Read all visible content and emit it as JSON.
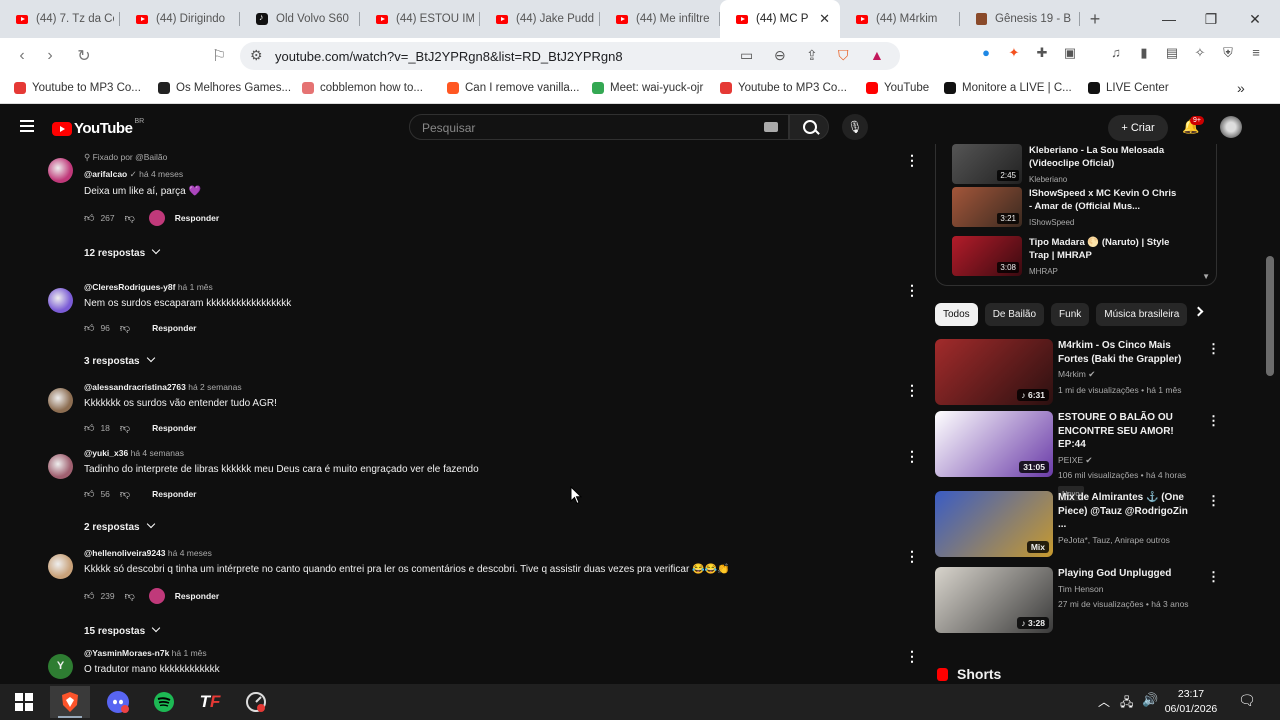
{
  "browser": {
    "tabs": [
      {
        "title": "(44) 7. Tz da Co",
        "icon": "youtube-icon"
      },
      {
        "title": "(44) Dirigindo",
        "icon": "youtube-icon"
      },
      {
        "title": "Old Volvo S60",
        "icon": "tiktok-icon"
      },
      {
        "title": "(44) ESTOU IM",
        "icon": "youtube-icon"
      },
      {
        "title": "(44) Jake Pudd",
        "icon": "youtube-icon"
      },
      {
        "title": "(44) Me infiltre",
        "icon": "youtube-icon"
      },
      {
        "title": "(44) MC P",
        "icon": "youtube-icon",
        "active": true
      },
      {
        "title": "(44) M4rkim",
        "icon": "youtube-icon"
      },
      {
        "title": "Gênesis 19 - B",
        "icon": "book-icon"
      }
    ],
    "new_tab": "+",
    "window_controls": {
      "minimize": "—",
      "maximize": "❐",
      "close": "✕"
    },
    "url": "youtube.com/watch?v=_BtJ2YPRgn8&list=RD_BtJ2YPRgn8",
    "brave_badge": "44",
    "bookmarks": [
      {
        "label": "Youtube to MP3 Co...",
        "color": "#e53935"
      },
      {
        "label": "Os Melhores Games...",
        "color": "#222"
      },
      {
        "label": "cobblemon how to...",
        "color": "#e57373"
      },
      {
        "label": "Can I remove vanilla...",
        "color": "#ff5722"
      },
      {
        "label": "Meet: wai-yuck-ojr",
        "color": "#34a853"
      },
      {
        "label": "Youtube to MP3 Co...",
        "color": "#e53935"
      },
      {
        "label": "YouTube",
        "color": "#ff0000"
      },
      {
        "label": "Monitore a LIVE | C...",
        "color": "#111"
      },
      {
        "label": "LIVE Center",
        "color": "#111"
      }
    ],
    "bookmarks_more": "»"
  },
  "youtube": {
    "logo_text": "YouTube",
    "logo_region": "BR",
    "search_placeholder": "Pesquisar",
    "create_label": "Criar",
    "notification_badge": "9+"
  },
  "comments": [
    {
      "pinned": "Fixado por @Bailão",
      "user": "@arifalcao",
      "verified": "✓",
      "time": "há 4 meses",
      "text": "Deixa um like aí, parça 💜",
      "likes": "267",
      "creator_heart": true,
      "reply_label": "Responder",
      "replies": "12 respostas",
      "avatar": "#c0397a"
    },
    {
      "user": "@CleresRodrigues-y8f",
      "time": "há 1 mês",
      "text": "Nem os surdos escaparam kkkkkkkkkkkkkkkkk",
      "likes": "96",
      "reply_label": "Responder",
      "replies": "3 respostas",
      "avatar": "#7b5cd6"
    },
    {
      "user": "@alessandracristina2763",
      "time": "há 2 semanas",
      "text": "Kkkkkkk os surdos vão entender tudo AGR!",
      "likes": "18",
      "reply_label": "Responder",
      "avatar": "#8d6e52"
    },
    {
      "user": "@yuki_x36",
      "time": "há 4 semanas",
      "text": "Tadinho do interprete de libras kkkkkk meu Deus cara é muito engraçado ver ele fazendo",
      "likes": "56",
      "reply_label": "Responder",
      "replies": "2 respostas",
      "avatar": "#a06070"
    },
    {
      "user": "@hellenoliveira9243",
      "time": "há 4 meses",
      "text": "Kkkkk só descobri q tinha um intérprete no canto quando entrei pra ler os comentários e descobri. Tive q assistir duas vezes pra verificar 😂😂👏",
      "likes": "239",
      "creator_heart": true,
      "reply_label": "Responder",
      "replies": "15 respostas",
      "avatar": "#c9a27a"
    },
    {
      "user": "@YasminMoraes-n7k",
      "time": "há 1 mês",
      "text": "O tradutor mano kkkkkkkkkkkk",
      "avatar": "#2e7d32",
      "avatar_letter": "Y"
    }
  ],
  "playlist": [
    {
      "title": "Kleberiano - La Sou Melosada (Videoclipe Oficial)",
      "channel": "Kleberiano",
      "duration": "2:45",
      "colors": [
        "#555",
        "#222"
      ]
    },
    {
      "title": "IShowSpeed x MC Kevin O Chris - Amar de (Official Mus...",
      "channel": "IShowSpeed",
      "duration": "3:21",
      "colors": [
        "#a3563a",
        "#3b2a20"
      ]
    },
    {
      "title": "Tipo Madara 🌕 (Naruto) | Style Trap | MHRAP",
      "channel": "MHRAP",
      "duration": "3:08",
      "colors": [
        "#b31c2a",
        "#3a0a10"
      ]
    }
  ],
  "chips": [
    {
      "label": "Todos",
      "active": true
    },
    {
      "label": "De Bailão"
    },
    {
      "label": "Funk"
    },
    {
      "label": "Música brasileira"
    }
  ],
  "videos": [
    {
      "title": "M4rkim - Os Cinco Mais Fortes (Baki the Grappler)",
      "channel": "M4rkim",
      "verified": true,
      "meta": "1 mi de visualizações • há 1 mês",
      "duration": "♪ 6:31",
      "colors": [
        "#a22b2b",
        "#2b1010"
      ]
    },
    {
      "title": "ESTOURE O BALÃO OU ENCONTRE SEU AMOR! EP:44",
      "channel": "PEIXE",
      "verified": true,
      "meta": "106 mil visualizações • há 4 horas",
      "new_badge": "Novo",
      "duration": "31:05",
      "colors": [
        "#ffffff",
        "#6a3ba8"
      ]
    },
    {
      "title": "Mix de Almirantes ⚓ (One Piece) @Tauz @RodrigoZin ...",
      "channel": "PeJota*, Tauz, Anirape outros",
      "meta": "",
      "duration": "Mix",
      "colors": [
        "#3a5cc4",
        "#c79a2e"
      ]
    },
    {
      "title": "Playing God Unplugged",
      "channel": "Tim Henson",
      "meta": "27 mi de visualizações • há 3 anos",
      "duration": "♪ 3:28",
      "colors": [
        "#d8d4cc",
        "#3a3a3a"
      ]
    }
  ],
  "shorts_label": "Shorts",
  "taskbar": {
    "apps": [
      "windows-start",
      "brave",
      "discord",
      "spotify",
      "tf",
      "cheat-engine"
    ],
    "time": "23:17",
    "date": "06/01/2026"
  }
}
